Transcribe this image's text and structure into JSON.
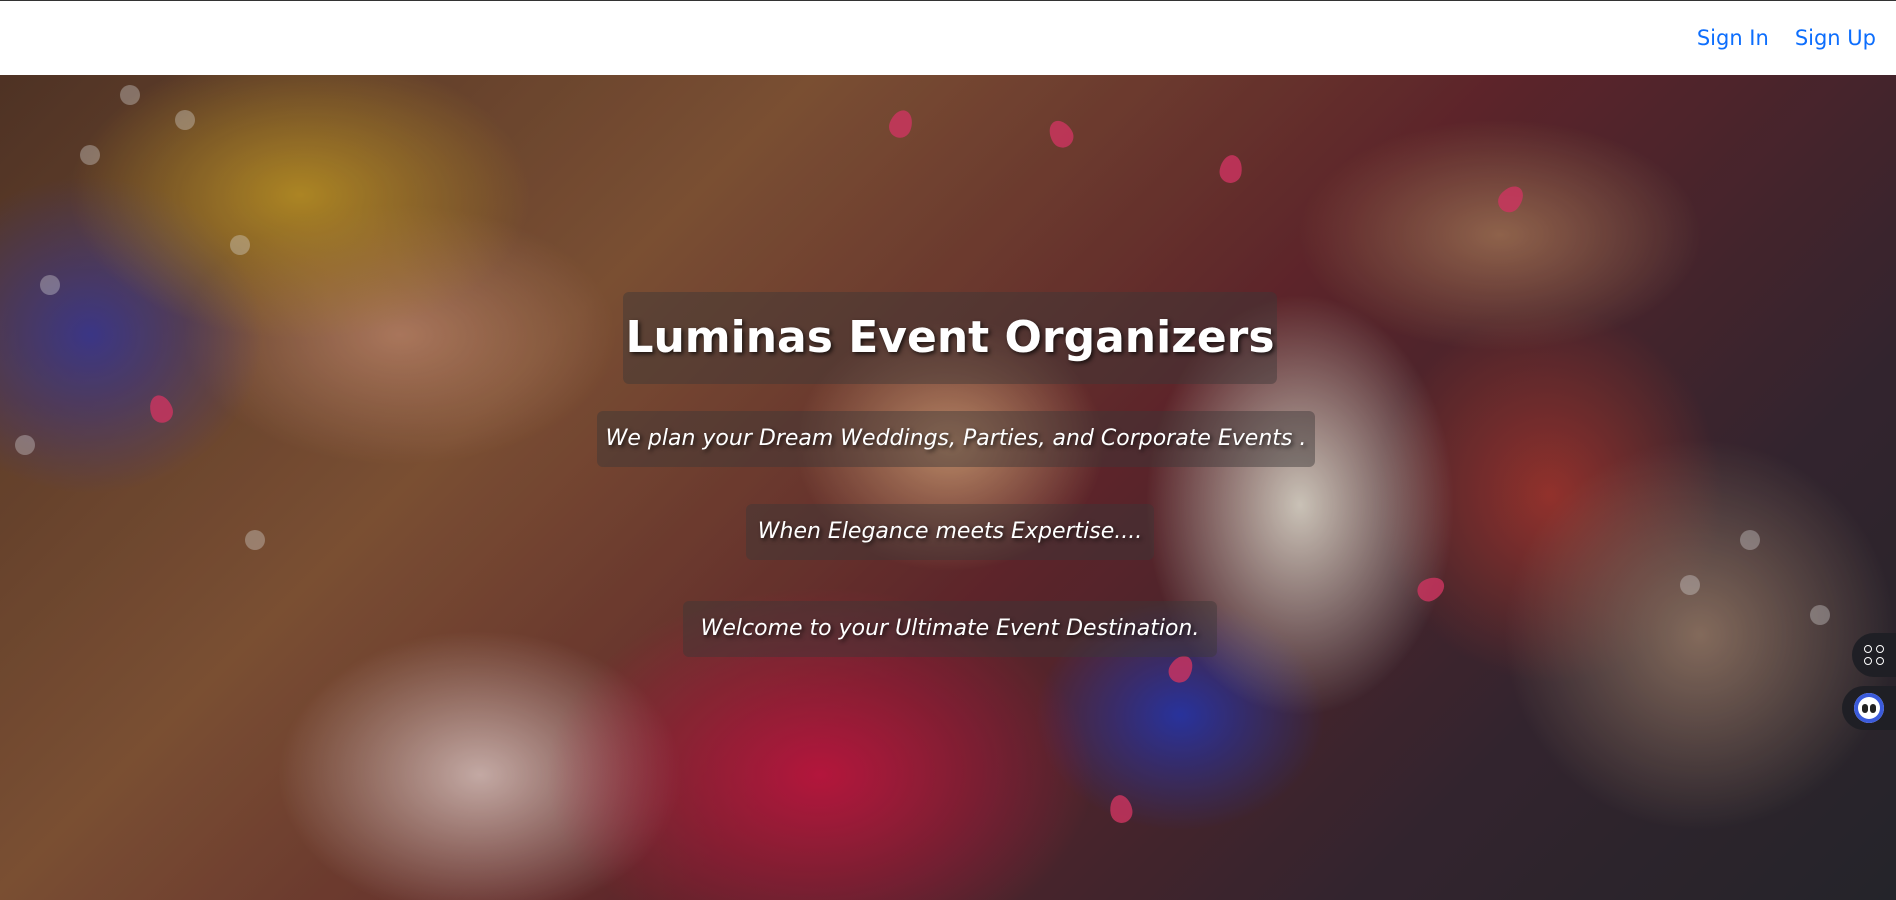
{
  "nav": {
    "sign_in": "Sign In",
    "sign_up": "Sign Up"
  },
  "hero": {
    "title": "Luminas Event Organizers",
    "tagline_1": "We plan your Dream Weddings, Parties, and Corporate Events .",
    "tagline_2": "When Elegance meets Expertise....",
    "tagline_3": "Welcome to your Ultimate Event Destination."
  },
  "side_tools": {
    "apps_icon": "grid-icon",
    "assistant_icon": "bot-face-icon"
  },
  "colors": {
    "link": "#0d6efd",
    "overlay_box": "rgba(60,55,55,0.45)",
    "side_button": "#1f1f25"
  }
}
